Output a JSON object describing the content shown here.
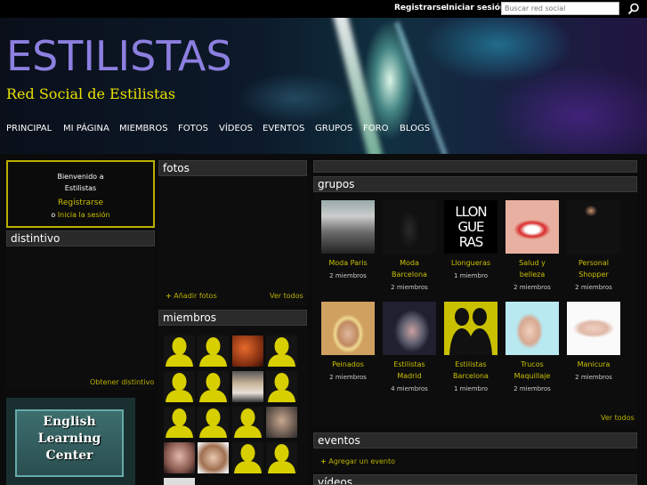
{
  "topbar": {
    "register": "Registrarse",
    "login": "Iniciar sesión",
    "search_placeholder": "Buscar red social",
    "search_icon": "search-icon"
  },
  "header": {
    "title": "ESTILISTAS",
    "subtitle": "Red Social de Estilistas"
  },
  "nav": {
    "items": [
      "PRINCIPAL",
      "MI PÁGINA",
      "MIEMBROS",
      "FOTOS",
      "VÍDEOS",
      "EVENTOS",
      "GRUPOS",
      "FORO",
      "BLOGS"
    ]
  },
  "welcome": {
    "line1": "Bienvenido a",
    "line2": "Estilistas",
    "register": "Registrarse",
    "or": "o",
    "login": "Inicia la sesión"
  },
  "badge": {
    "title": "distintivo",
    "get_badge": "Obtener distintivo"
  },
  "ad": {
    "line1": "English",
    "line2": "Learning",
    "line3": "Center"
  },
  "photos": {
    "title": "fotos",
    "add": "Añadir fotos",
    "view_all": "Ver todos"
  },
  "members": {
    "title": "miembros"
  },
  "groups": {
    "title": "grupos",
    "view_all": "Ver todos",
    "items": [
      {
        "name": "Moda Paris",
        "count": "2 miembros"
      },
      {
        "name": "Moda Barcelona",
        "count": "2 miembros"
      },
      {
        "name": "Llongueras",
        "count": "1 miembro"
      },
      {
        "name": "Salud y belleza",
        "count": "2 miembros"
      },
      {
        "name": "Personal Shopper",
        "count": "2 miembros"
      },
      {
        "name": "Peinados",
        "count": "2 miembros"
      },
      {
        "name": "Estilistas Madrid",
        "count": "4 miembros"
      },
      {
        "name": "Estilistas Barcelona",
        "count": "1 miembro"
      },
      {
        "name": "Trucos Maquillaje",
        "count": "2 miembros"
      },
      {
        "name": "Manicura",
        "count": "2 miembros"
      }
    ],
    "llongueras_logo": [
      "LLON",
      "GUE",
      "RAS"
    ]
  },
  "events": {
    "title": "eventos",
    "add": "Agregar un evento"
  },
  "videos": {
    "title": "vídeos"
  },
  "colors": {
    "accent": "#c9c000",
    "title_purple": "#8c7fe0",
    "subtitle_yellow": "#e8e000",
    "background": "#0b0b0b"
  }
}
